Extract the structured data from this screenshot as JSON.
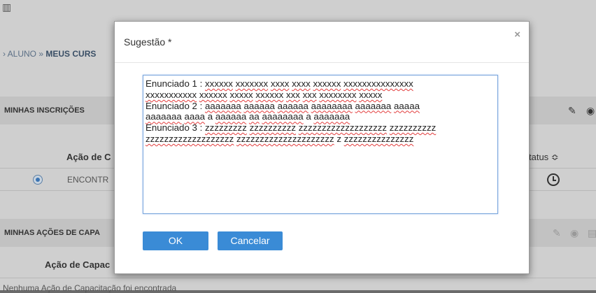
{
  "background": {
    "breadcrumb_prefix": "ALUNO » ",
    "breadcrumb_current": "MEUS CURS",
    "section1_title": "MINHAS INSCRIÇÕES",
    "col_acao": "Ação de C",
    "col_status": "tatus ≎",
    "row1_acao": "ENCONTR",
    "section2_title": "MINHAS AÇÕES DE CAPA",
    "col_acao_capac": "Ação de Capac",
    "empty_message": "Nenhuma Ação de Capacitação foi encontrada"
  },
  "modal": {
    "title": "Sugestão *",
    "close_symbol": "×",
    "text_lines": [
      [
        {
          "t": "Enunciado 1 : ",
          "s": false
        },
        {
          "t": "xxxxxx",
          "s": true
        },
        {
          "t": " ",
          "s": false
        },
        {
          "t": "xxxxxxx",
          "s": true
        },
        {
          "t": " ",
          "s": false
        },
        {
          "t": "xxxx",
          "s": true
        },
        {
          "t": " ",
          "s": false
        },
        {
          "t": "xxxx",
          "s": true
        },
        {
          "t": " ",
          "s": false
        },
        {
          "t": "xxxxxx",
          "s": true
        },
        {
          "t": " ",
          "s": false
        },
        {
          "t": "xxxxxxxxxxxxxxx",
          "s": true
        }
      ],
      [
        {
          "t": "xxxxxxxxxxx",
          "s": true
        },
        {
          "t": " ",
          "s": false
        },
        {
          "t": "xxxxxx",
          "s": true
        },
        {
          "t": " ",
          "s": false
        },
        {
          "t": "xxxxx",
          "s": true
        },
        {
          "t": "   ",
          "s": false
        },
        {
          "t": "xxxxxx",
          "s": true
        },
        {
          "t": " ",
          "s": false
        },
        {
          "t": "xxx",
          "s": true
        },
        {
          "t": " ",
          "s": false
        },
        {
          "t": "xxx",
          "s": true
        },
        {
          "t": " ",
          "s": false
        },
        {
          "t": "xxxxxxxx",
          "s": true
        },
        {
          "t": " ",
          "s": false
        },
        {
          "t": "xxxxx",
          "s": true
        }
      ],
      [
        {
          "t": "Enunciado 2 : ",
          "s": false
        },
        {
          "t": "aaaaaaa",
          "s": true
        },
        {
          "t": " ",
          "s": false
        },
        {
          "t": "aaaaaa",
          "s": true
        },
        {
          "t": " ",
          "s": false
        },
        {
          "t": "aaaaaa",
          "s": true
        },
        {
          "t": " ",
          "s": false
        },
        {
          "t": "aaaaaaaa",
          "s": true
        },
        {
          "t": " ",
          "s": false
        },
        {
          "t": "aaaaaaa",
          "s": true
        },
        {
          "t": " ",
          "s": false
        },
        {
          "t": "aaaaa",
          "s": true
        }
      ],
      [
        {
          "t": "aaaaaaa",
          "s": true
        },
        {
          "t": " ",
          "s": false
        },
        {
          "t": "aaaa",
          "s": true
        },
        {
          "t": " a ",
          "s": false
        },
        {
          "t": "aaaaaa",
          "s": true
        },
        {
          "t": " ",
          "s": false
        },
        {
          "t": "aa",
          "s": true
        },
        {
          "t": " ",
          "s": false
        },
        {
          "t": "aaaaaaaa",
          "s": true
        },
        {
          "t": " a ",
          "s": false
        },
        {
          "t": "aaaaaaa",
          "s": true
        }
      ],
      [
        {
          "t": "Enunciado 3 : ",
          "s": false
        },
        {
          "t": "zzzzzzzzz",
          "s": true
        },
        {
          "t": " ",
          "s": false
        },
        {
          "t": "zzzzzzzzzz",
          "s": true
        },
        {
          "t": " ",
          "s": false
        },
        {
          "t": "zzzzzzzzzzzzzzzzzzz",
          "s": true
        },
        {
          "t": " ",
          "s": false
        },
        {
          "t": "zzzzzzzzzz",
          "s": true
        }
      ],
      [
        {
          "t": "zzzzzzzzzzzzzzzzzzz",
          "s": true
        },
        {
          "t": "  ",
          "s": false
        },
        {
          "t": "zzzzzzzzzzzzzzzzzzzzz",
          "s": true
        },
        {
          "t": " z ",
          "s": false
        },
        {
          "t": "zzzzzzzzzzzzzzz",
          "s": true
        }
      ]
    ],
    "ok_label": "OK",
    "cancel_label": "Cancelar"
  },
  "colors": {
    "primary_button": "#3a8bd6",
    "overlay": "#6b6b6b",
    "textarea_focus_border": "#7aa6dc",
    "spellcheck_underline": "#e23b3b"
  },
  "icons": [
    "pencil-icon",
    "eye-icon",
    "print-icon",
    "clock-icon",
    "close-icon",
    "chevron-icon"
  ]
}
